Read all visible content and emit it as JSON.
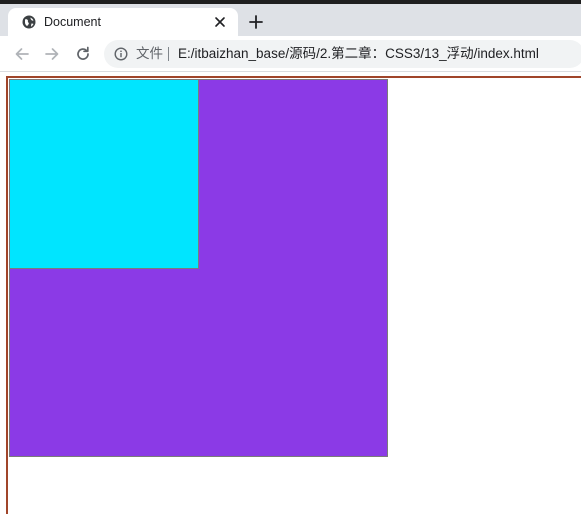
{
  "browser": {
    "tab": {
      "title": "Document",
      "favicon": "globe-icon",
      "close_icon": "close-icon"
    },
    "new_tab_icon": "plus-icon",
    "nav": {
      "back_icon": "arrow-left-icon",
      "forward_icon": "arrow-right-icon",
      "reload_icon": "reload-icon"
    },
    "omnibox": {
      "info_icon": "info-icon",
      "security_label": "文件",
      "url": "E:/itbaizhan_base/源码/2.第二章：CSS3/13_浮动/index.html"
    }
  },
  "page": {
    "body_border_color": "#a0452a",
    "big_box_color": "#8b3ae6",
    "small_box_color": "#00e5ff"
  }
}
